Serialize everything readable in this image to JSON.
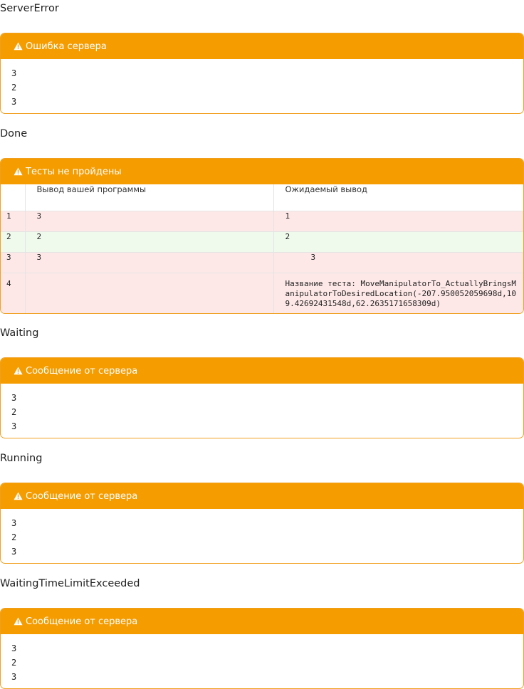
{
  "sections": [
    {
      "state": "ServerError",
      "panel_title": "Ошибка сервера",
      "lines": [
        "3",
        "2",
        "3"
      ]
    },
    {
      "state": "Done",
      "panel_title": "Тесты не пройдены",
      "table": {
        "headers": [
          "",
          "Вывод вашей программы",
          "Ожидаемый вывод"
        ],
        "rows": [
          {
            "num": "1",
            "output": "3",
            "expected": "1",
            "status": "fail"
          },
          {
            "num": "2",
            "output": "2",
            "expected": "2",
            "status": "pass"
          },
          {
            "num": "3",
            "output": "3",
            "expected": "3",
            "status": "fail"
          },
          {
            "num": "4",
            "output": "",
            "expected": "Название теста: MoveManipulatorTo_ActuallyBringsManipulatorToDesiredLocation(-207.950052059698d,109.42692431548d,62.2635171658309d)",
            "status": "fail"
          }
        ]
      }
    },
    {
      "state": "Waiting",
      "panel_title": "Сообщение от сервера",
      "lines": [
        "3",
        "2",
        "3"
      ]
    },
    {
      "state": "Running",
      "panel_title": "Сообщение от сервера",
      "lines": [
        "3",
        "2",
        "3"
      ]
    },
    {
      "state": "WaitingTimeLimitExceeded",
      "panel_title": "Сообщение от сервера",
      "lines": [
        "3",
        "2",
        "3"
      ]
    }
  ],
  "colors": {
    "panel_header": "#f59c00",
    "row_fail": "#fde8e7",
    "row_pass": "#eff9ec"
  },
  "icons": {
    "panel_header_icon": "warning-triangle-icon"
  }
}
